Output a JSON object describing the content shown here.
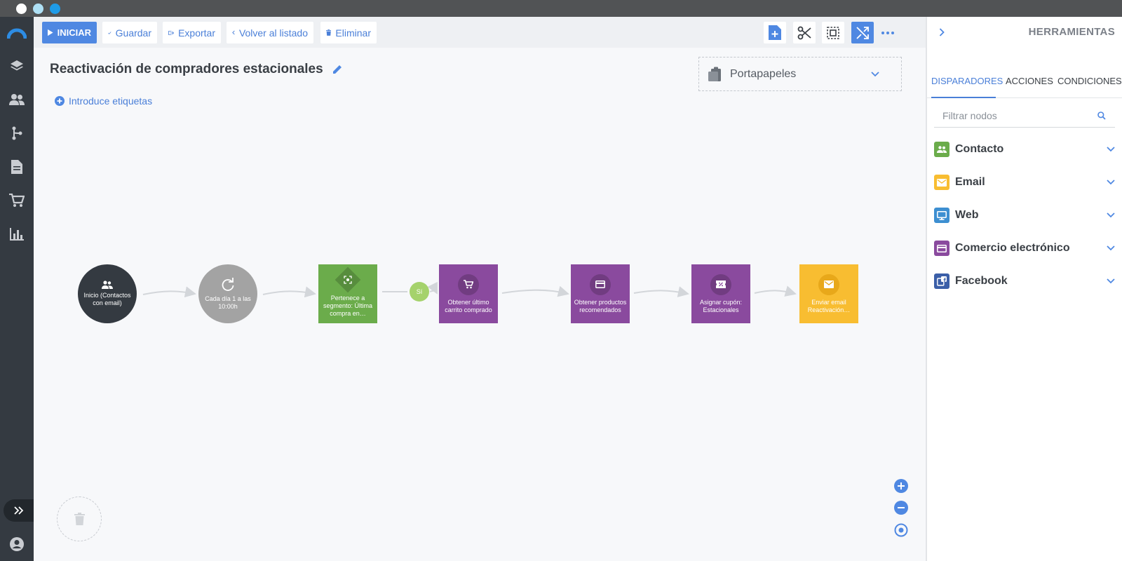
{
  "window": {
    "dots": [
      "#ffffff",
      "#aee0f5",
      "#1e9be8"
    ]
  },
  "sidebar": {
    "brand_color": "#2d8ce3",
    "items": [
      {
        "name": "brand-logo-icon"
      },
      {
        "name": "layers-icon"
      },
      {
        "name": "contacts-icon"
      },
      {
        "name": "automation-icon"
      },
      {
        "name": "document-icon"
      },
      {
        "name": "cart-icon"
      },
      {
        "name": "chart-icon"
      }
    ]
  },
  "toolbar": {
    "start_label": "INICIAR",
    "save_label": "Guardar",
    "export_label": "Exportar",
    "back_label": "Volver al listado",
    "delete_label": "Eliminar",
    "accent_color": "#4f88e2"
  },
  "canvas": {
    "title": "Reactivación de compradores estacionales",
    "tags_label": "Introduce etiquetas",
    "clipboard_label": "Portapapeles",
    "branch_label": "Sí",
    "nodes": [
      {
        "label": "Inicio (Contactos con email)",
        "icon": "users-icon",
        "color": "#343a41",
        "shape": "circle"
      },
      {
        "label": "Cada día 1 a las 10:00h",
        "icon": "refresh-icon",
        "color": "#a3a3a3",
        "shape": "circle"
      },
      {
        "label": "Pertenece a segmento: Última compra en…",
        "icon": "segment-icon",
        "color": "#6bac4b",
        "shape": "square"
      },
      {
        "label": "Obtener último carrito comprado",
        "icon": "cart-icon",
        "color": "#8a4a9e",
        "shape": "square"
      },
      {
        "label": "Obtener productos recomendados",
        "icon": "card-icon",
        "color": "#8a4a9e",
        "shape": "square"
      },
      {
        "label": "Asignar cupón: Estacionales",
        "icon": "coupon-icon",
        "color": "#8a4a9e",
        "shape": "square"
      },
      {
        "label": "Enviar email Reactivación…",
        "icon": "mail-icon",
        "color": "#f8bd31",
        "shape": "square"
      }
    ]
  },
  "panel": {
    "title": "HERRAMIENTAS",
    "tabs": [
      "DISPARADORES",
      "ACCIONES",
      "CONDICIONES"
    ],
    "active_tab": "DISPARADORES",
    "filter_placeholder": "Filtrar nodos",
    "categories": [
      {
        "label": "Contacto",
        "color": "#6bac4b",
        "icon": "contacts-icon"
      },
      {
        "label": "Email",
        "color": "#f8bd31",
        "icon": "mail-icon"
      },
      {
        "label": "Web",
        "color": "#3d8fd1",
        "icon": "monitor-icon"
      },
      {
        "label": "Comercio electrónico",
        "color": "#8a4a9e",
        "icon": "card-icon"
      },
      {
        "label": "Facebook",
        "color": "#3b5fa8",
        "icon": "facebook-icon"
      }
    ]
  }
}
